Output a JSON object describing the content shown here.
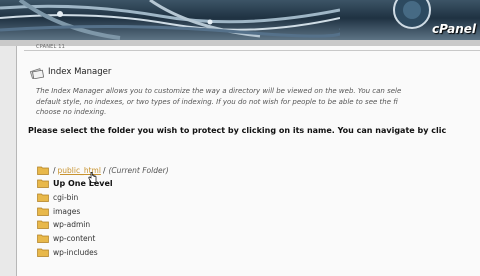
{
  "header": {
    "logo_text": "cPanel V",
    "breadcrumb": "CPANEL 11"
  },
  "page": {
    "title": "Index Manager",
    "description_lines": [
      "The Index Manager allows you to customize the way a directory will be viewed on the web. You can sele",
      "default style, no indexes, or two types of indexing. If you do not wish for people to be able to see the fi",
      "choose no indexing."
    ],
    "select_message": "Please select the folder you wish to protect by clicking on its name. You can navigate by clic"
  },
  "folders": {
    "current": {
      "prefix": "/",
      "link": "public_html",
      "separator": "/",
      "note": "(Current Folder)"
    },
    "up_one_level": "Up One Level",
    "items": [
      "cgi-bin",
      "images",
      "wp-admin",
      "wp-content",
      "wp-includes"
    ]
  },
  "colors": {
    "folder_icon": "#e8b84a",
    "link": "#c8932f"
  }
}
